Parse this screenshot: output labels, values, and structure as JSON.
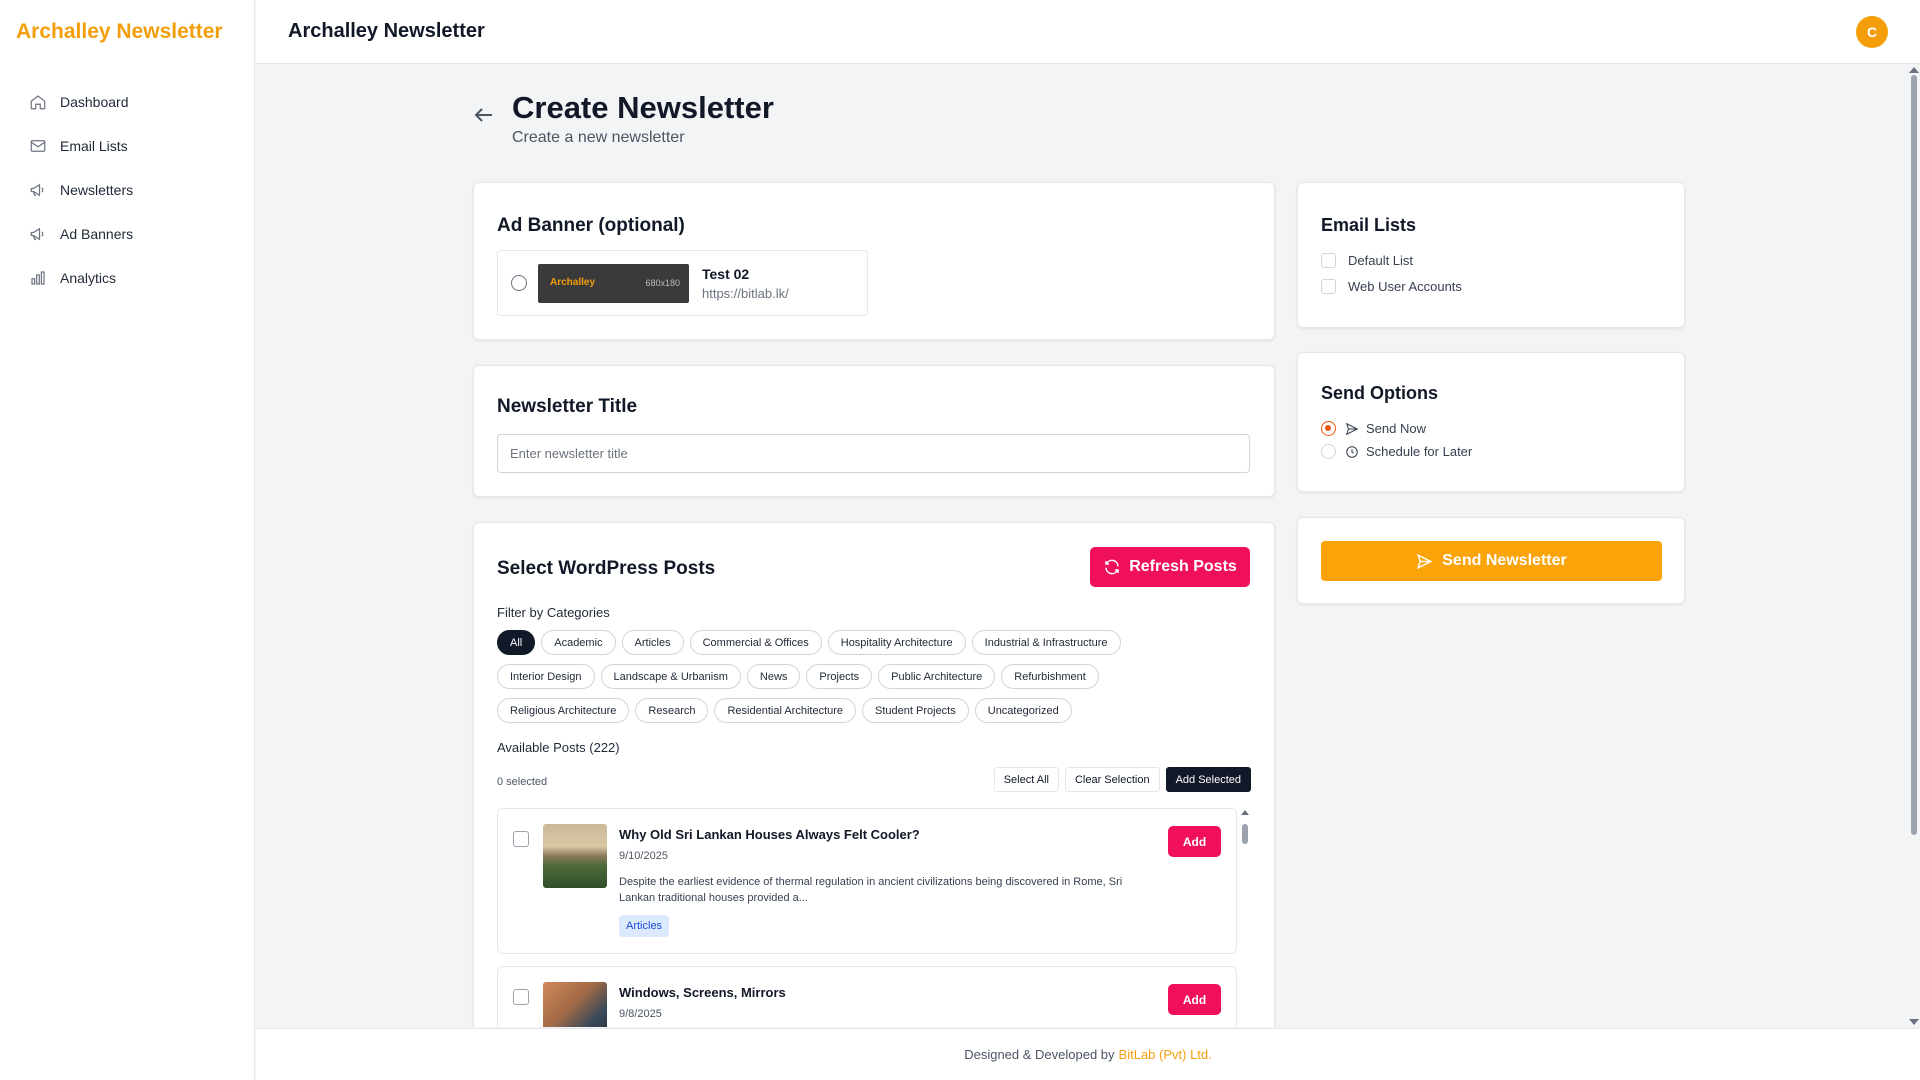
{
  "app": {
    "brand": "Archalley Newsletter",
    "header_title": "Archalley Newsletter",
    "avatar_initial": "C"
  },
  "sidebar": {
    "items": [
      {
        "label": "Dashboard",
        "icon": "home-icon"
      },
      {
        "label": "Email Lists",
        "icon": "mail-icon"
      },
      {
        "label": "Newsletters",
        "icon": "megaphone-icon"
      },
      {
        "label": "Ad Banners",
        "icon": "megaphone-icon"
      },
      {
        "label": "Analytics",
        "icon": "bar-chart-icon"
      }
    ]
  },
  "page": {
    "title": "Create Newsletter",
    "subtitle": "Create a new newsletter"
  },
  "ad_banner": {
    "title": "Ad Banner (optional)",
    "option": {
      "name": "Test 02",
      "url": "https://bitlab.lk/",
      "image_logo": "Archalley",
      "image_size": "680x180"
    }
  },
  "newsletter_title": {
    "title": "Newsletter Title",
    "placeholder": "Enter newsletter title",
    "value": ""
  },
  "posts": {
    "title": "Select WordPress Posts",
    "refresh_label": "Refresh Posts",
    "filter_label": "Filter by Categories",
    "categories_rows": [
      [
        "All",
        "Academic",
        "Articles",
        "Commercial & Offices",
        "Hospitality Architecture",
        "Industrial & Infrastructure"
      ],
      [
        "Interior Design",
        "Landscape & Urbanism",
        "News",
        "Projects",
        "Public Architecture",
        "Refurbishment"
      ],
      [
        "Religious Architecture",
        "Research",
        "Residential Architecture",
        "Student Projects",
        "Uncategorized"
      ]
    ],
    "active_category": "All",
    "available_label": "Available Posts (222)",
    "selected_label": "0 selected",
    "select_all": "Select All",
    "clear_selection": "Clear Selection",
    "add_selected": "Add Selected",
    "items": [
      {
        "title": "Why Old Sri Lankan Houses Always Felt Cooler?",
        "date": "9/10/2025",
        "excerpt": "Despite the earliest evidence of thermal regulation in ancient civilizations being discovered in Rome, Sri Lankan traditional houses provided a...",
        "tag": "Articles",
        "add_label": "Add"
      },
      {
        "title": "Windows, Screens, Mirrors",
        "date": "9/8/2025",
        "add_label": "Add"
      }
    ]
  },
  "email_lists": {
    "title": "Email Lists",
    "items": [
      "Default List",
      "Web User Accounts"
    ]
  },
  "send_options": {
    "title": "Send Options",
    "items": [
      "Send Now",
      "Schedule for Later"
    ],
    "selected": "Send Now"
  },
  "action": {
    "send_label": "Send Newsletter"
  },
  "footer": {
    "text": "Designed & Developed by",
    "link": "BitLab (Pvt) Ltd."
  },
  "colors": {
    "brand": "#f59e0b",
    "accent_pink": "#f0105a",
    "send_button": "#fba40a",
    "radio_selected": "#ea580c"
  }
}
